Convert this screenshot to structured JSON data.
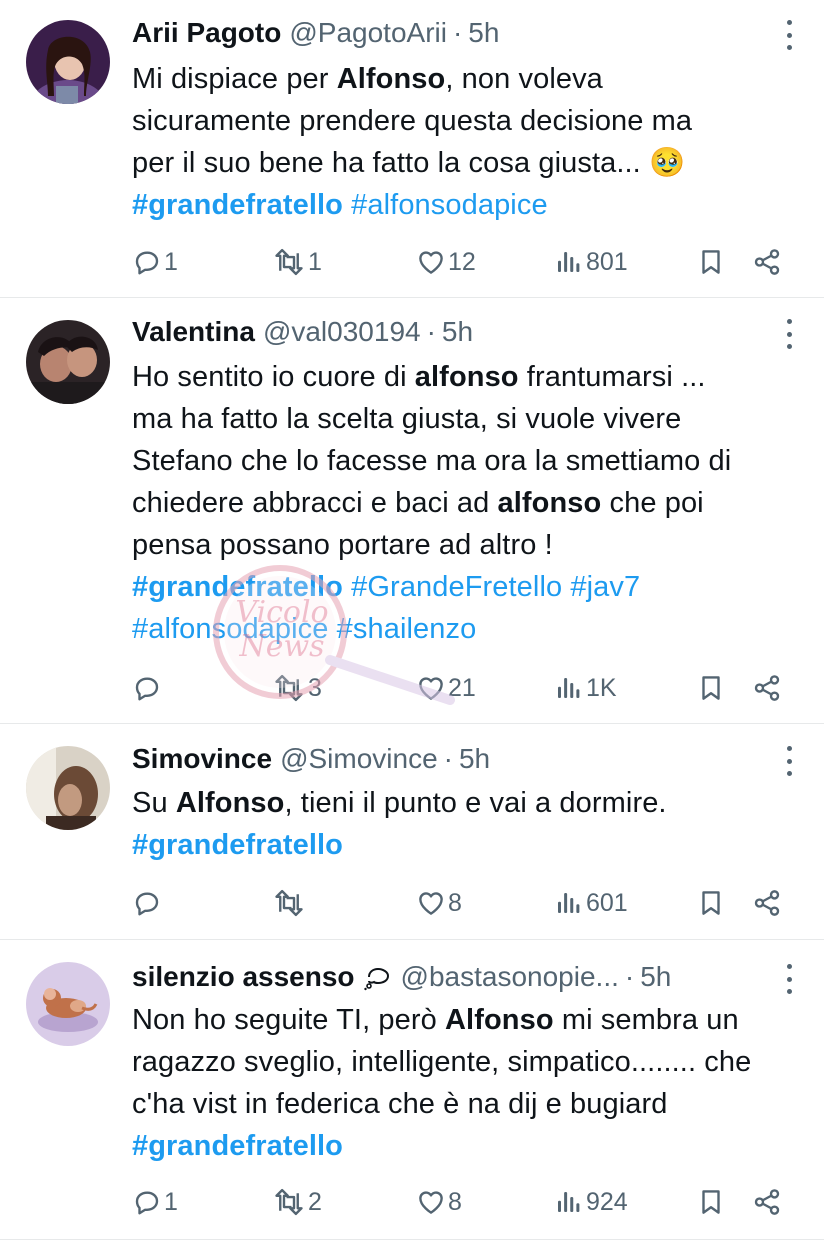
{
  "colors": {
    "text": "#0f1419",
    "muted": "#536471",
    "link": "#1d9bf0",
    "divider": "#e7e9ea"
  },
  "tweets": [
    {
      "name": "Arii Pagoto",
      "handle": "@PagotoArii",
      "time": "5h",
      "lines": [
        [
          {
            "t": "Mi dispiace per "
          },
          {
            "t": "Alfonso",
            "b": true
          },
          {
            "t": ", non voleva"
          }
        ],
        [
          {
            "t": "sicuramente prendere questa decisione ma"
          }
        ],
        [
          {
            "t": "per il suo bene ha fatto la cosa giusta... "
          },
          {
            "t": "🥹"
          }
        ],
        [
          {
            "t": "#grandefratello",
            "tag": true,
            "b": true
          },
          {
            "t": " "
          },
          {
            "t": "#alfonsodapice",
            "tag": true
          }
        ]
      ],
      "replies": "1",
      "reposts": "1",
      "likes": "12",
      "views": "801"
    },
    {
      "name": "Valentina",
      "handle": "@val030194",
      "time": "5h",
      "lines": [
        [
          {
            "t": "Ho sentito io cuore di "
          },
          {
            "t": "alfonso",
            "b": true
          },
          {
            "t": " frantumarsi ..."
          }
        ],
        [
          {
            "t": "ma ha fatto la scelta giusta, si vuole vivere"
          }
        ],
        [
          {
            "t": "Stefano che lo facesse ma ora la smettiamo di"
          }
        ],
        [
          {
            "t": "chiedere abbracci e baci ad "
          },
          {
            "t": "alfonso",
            "b": true
          },
          {
            "t": " che poi"
          }
        ],
        [
          {
            "t": "pensa possano portare ad altro !"
          }
        ],
        [
          {
            "t": "#grandefratello",
            "tag": true,
            "b": true
          },
          {
            "t": " "
          },
          {
            "t": "#GrandeFretello",
            "tag": true
          },
          {
            "t": " "
          },
          {
            "t": "#jav7",
            "tag": true
          }
        ],
        [
          {
            "t": "#alfonsodapice",
            "tag": true
          },
          {
            "t": " "
          },
          {
            "t": "#shailenzo",
            "tag": true
          }
        ]
      ],
      "replies": "",
      "reposts": "3",
      "likes": "21",
      "views": "1K"
    },
    {
      "name": "Simovince",
      "handle": "@Simovince",
      "time": "5h",
      "lines": [
        [
          {
            "t": "Su "
          },
          {
            "t": "Alfonso",
            "b": true
          },
          {
            "t": ", tieni il punto e vai a dormire."
          }
        ],
        [
          {
            "t": "#grandefratello",
            "tag": true,
            "b": true
          }
        ]
      ],
      "replies": "",
      "reposts": "",
      "likes": "8",
      "views": "601"
    },
    {
      "name": "silenzio assenso",
      "handle": "@bastasonopie...",
      "time": "5h",
      "lines": [
        [
          {
            "t": "Non ho seguite TI, però "
          },
          {
            "t": "Alfonso",
            "b": true
          },
          {
            "t": " mi sembra un"
          }
        ],
        [
          {
            "t": "ragazzo sveglio, intelligente, simpatico........ che"
          }
        ],
        [
          {
            "t": "c'ha vist in federica che è na dij e bugiard"
          }
        ],
        [
          {
            "t": "#grandefratello",
            "tag": true,
            "b": true
          }
        ]
      ],
      "replies": "1",
      "reposts": "2",
      "likes": "8",
      "views": "924"
    }
  ],
  "watermark": {
    "text_top": "Vicolo",
    "text_bottom": "News"
  }
}
